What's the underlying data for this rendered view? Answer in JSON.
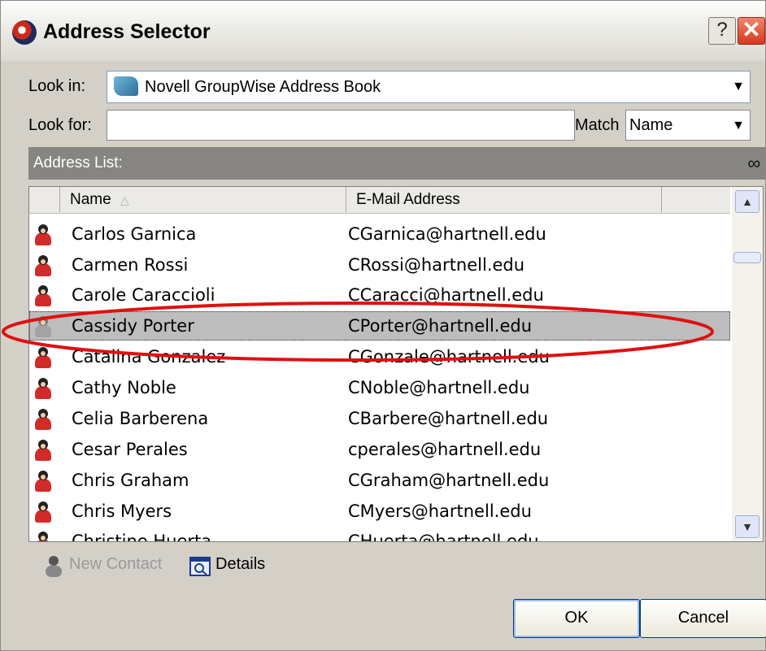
{
  "window": {
    "title": "Address Selector",
    "help_label": "?",
    "close_label": "✕"
  },
  "lookin": {
    "label": "Look in:",
    "value": "Novell GroupWise Address Book"
  },
  "lookfor": {
    "label": "Look for:",
    "value": ""
  },
  "match": {
    "label": "Match",
    "value": "Name"
  },
  "address_list": {
    "header": "Address List:",
    "columns": [
      "Name",
      "E-Mail Address"
    ],
    "sort_indicator": "△",
    "rows": [
      {
        "name": "Carlos Garnica",
        "email": "CGarnica@hartnell.edu"
      },
      {
        "name": "Carmen Rossi",
        "email": "CRossi@hartnell.edu"
      },
      {
        "name": "Carole Caraccioli",
        "email": "CCaracci@hartnell.edu"
      },
      {
        "name": "Cassidy Porter",
        "email": "CPorter@hartnell.edu"
      },
      {
        "name": "Catalina Gonzalez",
        "email": "CGonzale@hartnell.edu"
      },
      {
        "name": "Cathy Noble",
        "email": "CNoble@hartnell.edu"
      },
      {
        "name": "Celia Barberena",
        "email": "CBarbere@hartnell.edu"
      },
      {
        "name": "Cesar Perales",
        "email": "cperales@hartnell.edu"
      },
      {
        "name": "Chris Graham",
        "email": "CGraham@hartnell.edu"
      },
      {
        "name": "Chris Myers",
        "email": "CMyers@hartnell.edu"
      },
      {
        "name": "Christine Huerta",
        "email": "CHuerta@hartnell.edu"
      }
    ]
  },
  "toolbar": {
    "new_contact_label": "New Contact",
    "details_label": "Details"
  },
  "buttons": {
    "ok_label": "OK",
    "cancel_label": "Cancel"
  },
  "colors": {
    "selection": "#bdbdbd",
    "highlight_ellipse": "#e01010",
    "header_bar": "#878581"
  }
}
